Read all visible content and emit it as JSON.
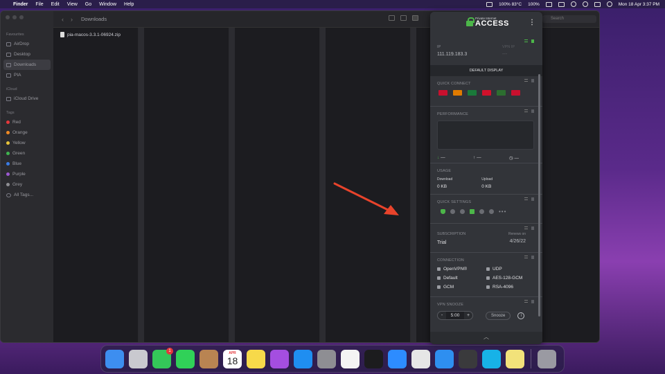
{
  "menubar": {
    "app_name": "Finder",
    "menus": [
      "File",
      "Edit",
      "View",
      "Go",
      "Window",
      "Help"
    ],
    "status_temp": "100% 83°C",
    "status_battery": "100%",
    "datetime": "Mon 18 Apr  3:37 PM"
  },
  "finder": {
    "title": "Downloads",
    "search_placeholder": "Search",
    "sidebar": {
      "favourites_head": "Favourites",
      "favourites": [
        "AirDrop",
        "Desktop",
        "Downloads",
        "PIA"
      ],
      "icloud_head": "iCloud",
      "icloud": [
        "iCloud Drive"
      ],
      "tags_head": "Tags",
      "tags": [
        {
          "label": "Red",
          "color": "#e5383b"
        },
        {
          "label": "Orange",
          "color": "#f08a24"
        },
        {
          "label": "Yellow",
          "color": "#e8c33a"
        },
        {
          "label": "Green",
          "color": "#3fb34f"
        },
        {
          "label": "Blue",
          "color": "#3a7be5"
        },
        {
          "label": "Purple",
          "color": "#9b59d0"
        },
        {
          "label": "Grey",
          "color": "#8e8e93"
        }
      ],
      "all_tags": "All Tags..."
    },
    "file_name": "pia-macos-3.3.1-06924.zip"
  },
  "pia": {
    "logo_small": "Private Internet",
    "logo_big": "ACCESS",
    "ip_label": "IP",
    "ip_value": "111.119.183.3",
    "vpn_ip_label": "VPN IP",
    "vpn_ip_value": "---",
    "default_display": "DEFAULT DISPLAY",
    "quick_connect": "QUICK CONNECT",
    "flag_colors": [
      "#c8102e",
      "#e07b00",
      "#1a7a3a",
      "#d0112b",
      "#2c6e2f",
      "#c8102e"
    ],
    "performance": "PERFORMANCE",
    "perf_down": "—",
    "perf_up": "—",
    "perf_time": "—",
    "usage": "USAGE",
    "download_label": "Download",
    "download_value": "0 KB",
    "upload_label": "Upload",
    "upload_value": "0 KB",
    "quick_settings": "QUICK SETTINGS",
    "qs_more": "•••",
    "subscription": "SUBSCRIPTION",
    "subscription_value": "Trial",
    "renews_label": "Renews on",
    "renews_value": "4/26/22",
    "connection": "CONNECTION",
    "conn_protocol": "OpenVPN®",
    "conn_transport": "UDP",
    "conn_port": "Default",
    "conn_encryption": "AES-128-GCM",
    "conn_auth": "GCM",
    "conn_handshake": "RSA-4096",
    "vpn_snooze": "VPN SNOOZE",
    "snooze_minus": "-",
    "snooze_value": "5:00",
    "snooze_plus": "+",
    "snooze_button": "Snooze",
    "info": "i",
    "collapse": "︿",
    "accent": "#4cb649"
  },
  "dock": {
    "facetime_badge": "1",
    "calendar_month": "APR",
    "calendar_day": "18",
    "apps": [
      {
        "name": "finder",
        "color": "#3d8ef0"
      },
      {
        "name": "launchpad",
        "color": "#c9c9cf"
      },
      {
        "name": "facetime",
        "color": "#34c759"
      },
      {
        "name": "messages",
        "color": "#30d158"
      },
      {
        "name": "contacts",
        "color": "#b98452"
      },
      {
        "name": "calendar",
        "color": "#ffffff"
      },
      {
        "name": "notes",
        "color": "#f7d94a"
      },
      {
        "name": "podcasts",
        "color": "#a44ee0"
      },
      {
        "name": "app-store",
        "color": "#1f8ef1"
      },
      {
        "name": "system-preferences",
        "color": "#8e8e93"
      },
      {
        "name": "slack",
        "color": "#f4f4f4"
      },
      {
        "name": "terminal",
        "color": "#1c1c1e"
      },
      {
        "name": "zoom",
        "color": "#2d8cff"
      },
      {
        "name": "chrome",
        "color": "#e6e6e6"
      },
      {
        "name": "safari",
        "color": "#2e8ff0"
      },
      {
        "name": "calculator",
        "color": "#3a3a3c"
      },
      {
        "name": "kodi",
        "color": "#17b2e7"
      },
      {
        "name": "stickies",
        "color": "#f2e27a"
      }
    ],
    "trash_color": "#9a9aa2"
  }
}
